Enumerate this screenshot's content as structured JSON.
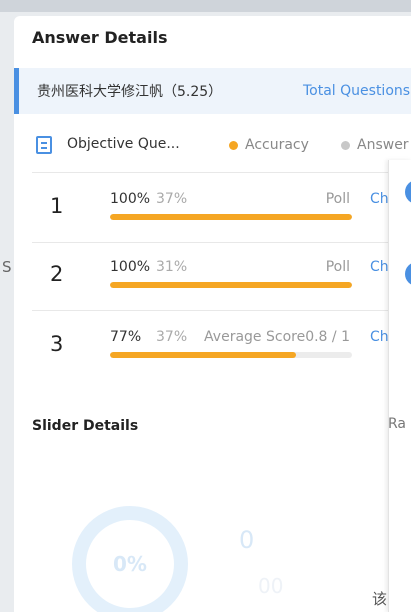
{
  "background": {
    "left_text": "S"
  },
  "header": {
    "title": "Answer Details"
  },
  "survey": {
    "title": "贵州医科大学修江帆（5.25）",
    "total_link": "Total Questions"
  },
  "section": {
    "title": "Objective Que...",
    "legend_accuracy": "Accuracy",
    "legend_answer": "Answer"
  },
  "questions": [
    {
      "num": "1",
      "accuracy": "100%",
      "answer": "37%",
      "type": "Poll",
      "check": "Che",
      "fill": 1.0
    },
    {
      "num": "2",
      "accuracy": "100%",
      "answer": "31%",
      "type": "Poll",
      "check": "Che",
      "fill": 1.0
    },
    {
      "num": "3",
      "accuracy": "77%",
      "answer": "37%",
      "type": "Average Score0.8 / 1",
      "check": "Che",
      "fill": 0.77
    }
  ],
  "slider": {
    "heading": "Slider Details"
  },
  "stats": {
    "ring_text": "0%",
    "big": "0",
    "small": "00"
  },
  "side": {
    "label": "Ra",
    "bottom": "该"
  },
  "colors": {
    "accent": "#4a90e2",
    "accuracy": "#f5a623",
    "answer": "#c8c8c8"
  }
}
